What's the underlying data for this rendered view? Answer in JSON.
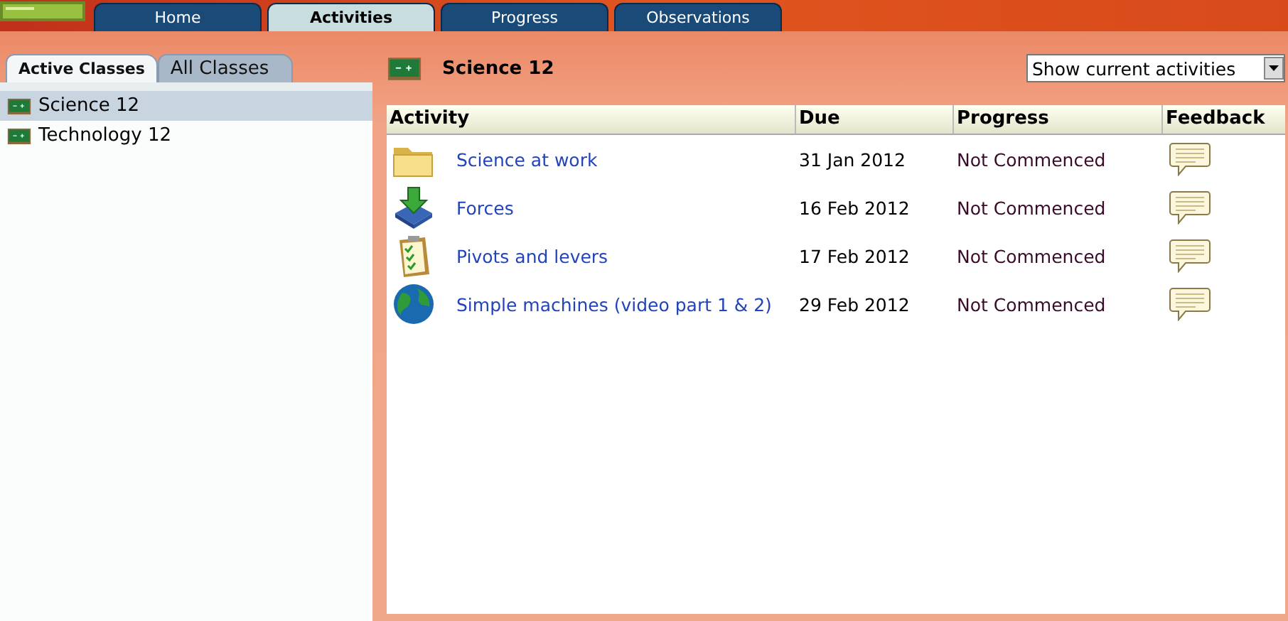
{
  "nav_tabs": [
    {
      "label": "Home",
      "selected": false
    },
    {
      "label": "Activities",
      "selected": true
    },
    {
      "label": "Progress",
      "selected": false
    },
    {
      "label": "Observations",
      "selected": false
    }
  ],
  "class_tabs": [
    {
      "label": "Active Classes",
      "selected": true
    },
    {
      "label": "All Classes",
      "selected": false
    }
  ],
  "classes": [
    {
      "name": "Science 12",
      "selected": true
    },
    {
      "name": "Technology 12",
      "selected": false
    }
  ],
  "class_title": "Science 12",
  "filter": {
    "value": "Show current activities"
  },
  "table": {
    "columns": [
      "Activity",
      "Due",
      "Progress",
      "Feedback"
    ],
    "rows": [
      {
        "kind": "folder",
        "activity": "Science at work",
        "due": "31 Jan 2012",
        "progress": "Not Commenced"
      },
      {
        "kind": "download",
        "activity": "Forces",
        "due": "16 Feb 2012",
        "progress": "Not Commenced"
      },
      {
        "kind": "checklist",
        "activity": "Pivots and levers",
        "due": "17 Feb 2012",
        "progress": "Not Commenced"
      },
      {
        "kind": "globe",
        "activity": "Simple machines (video part 1 & 2)",
        "due": "29 Feb 2012",
        "progress": "Not Commenced"
      }
    ]
  }
}
